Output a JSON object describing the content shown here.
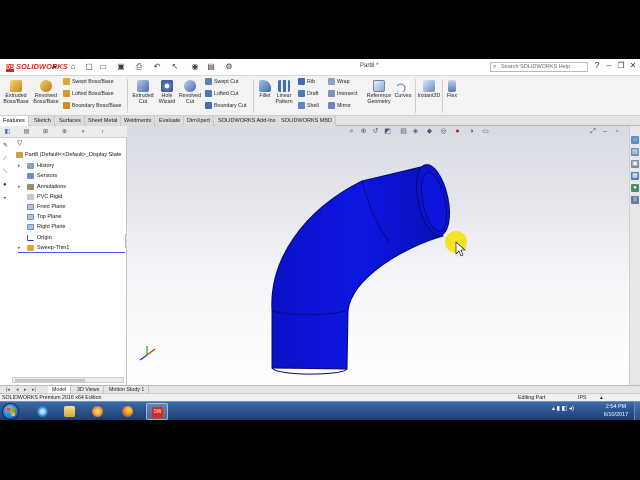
{
  "app": {
    "logo_text": "SOLIDWORKS",
    "document_title": "Part8 *",
    "help_search_placeholder": "Search SOLIDWORKS Help"
  },
  "ribbon": {
    "extruded_boss": "Extruded Boss/Base",
    "revolved_boss": "Revolved Boss/Base",
    "swept_boss": "Swept Boss/Base",
    "lofted_boss": "Lofted Boss/Base",
    "boundary_boss": "Boundary Boss/Base",
    "extruded_cut": "Extruded Cut",
    "hole_wizard": "Hole Wizard",
    "revolved_cut": "Revolved Cut",
    "swept_cut": "Swept Cut",
    "lofted_cut": "Lofted Cut",
    "boundary_cut": "Boundary Cut",
    "fillet": "Fillet",
    "linear_pattern": "Linear Pattern",
    "rib": "Rib",
    "draft": "Draft",
    "shell": "Shell",
    "wrap": "Wrap",
    "intersect": "Intersect",
    "mirror": "Mirror",
    "reference_geometry": "Reference Geometry",
    "curves": "Curves",
    "instant3d": "Instant3D",
    "flex": "Flex"
  },
  "tabs": [
    "Features",
    "Sketch",
    "Surfaces",
    "Sheet Metal",
    "Weldments",
    "Evaluate",
    "DimXpert",
    "SOLIDWORKS Add-Ins",
    "SOLIDWORKS MBD"
  ],
  "tree": {
    "root": "Part8  (Default<<Default>_Display State",
    "items": [
      "History",
      "Sensors",
      "Annotations",
      "PVC Rigid",
      "Front Plane",
      "Top Plane",
      "Right Plane",
      "Origin",
      "Sweep-Thin1"
    ]
  },
  "bottom_tabs": [
    "Model",
    "3D Views",
    "Motion Study 1"
  ],
  "status": {
    "edition": "SOLIDWORKS Premium 2016 x64 Edition",
    "mode": "Editing Part",
    "units": "IPS"
  },
  "clock": {
    "time": "2:54 PM",
    "date": "6/10/2017"
  },
  "colors": {
    "model_fill": "#0b13d6",
    "model_dark": "#05086e",
    "cursor_highlight": "#f2e200",
    "accent": "#d52b1e"
  }
}
